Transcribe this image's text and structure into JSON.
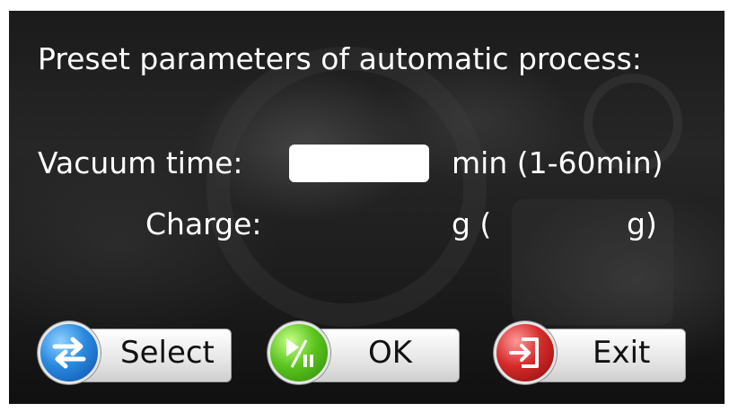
{
  "title": "Preset parameters of automatic process:",
  "vacuum": {
    "label": "Vacuum time:",
    "value": "",
    "unit_range": "min (1-60min)"
  },
  "charge": {
    "label": "Charge:",
    "unit_open": "g (",
    "unit_close": "g)"
  },
  "buttons": {
    "select": {
      "label": "Select",
      "icon": "swap-arrows-icon",
      "color": "#2a8ae0"
    },
    "ok": {
      "label": "OK",
      "icon": "play-pause-icon",
      "color": "#5cc51f"
    },
    "exit": {
      "label": "Exit",
      "icon": "exit-door-icon",
      "color": "#d62b2b"
    }
  }
}
